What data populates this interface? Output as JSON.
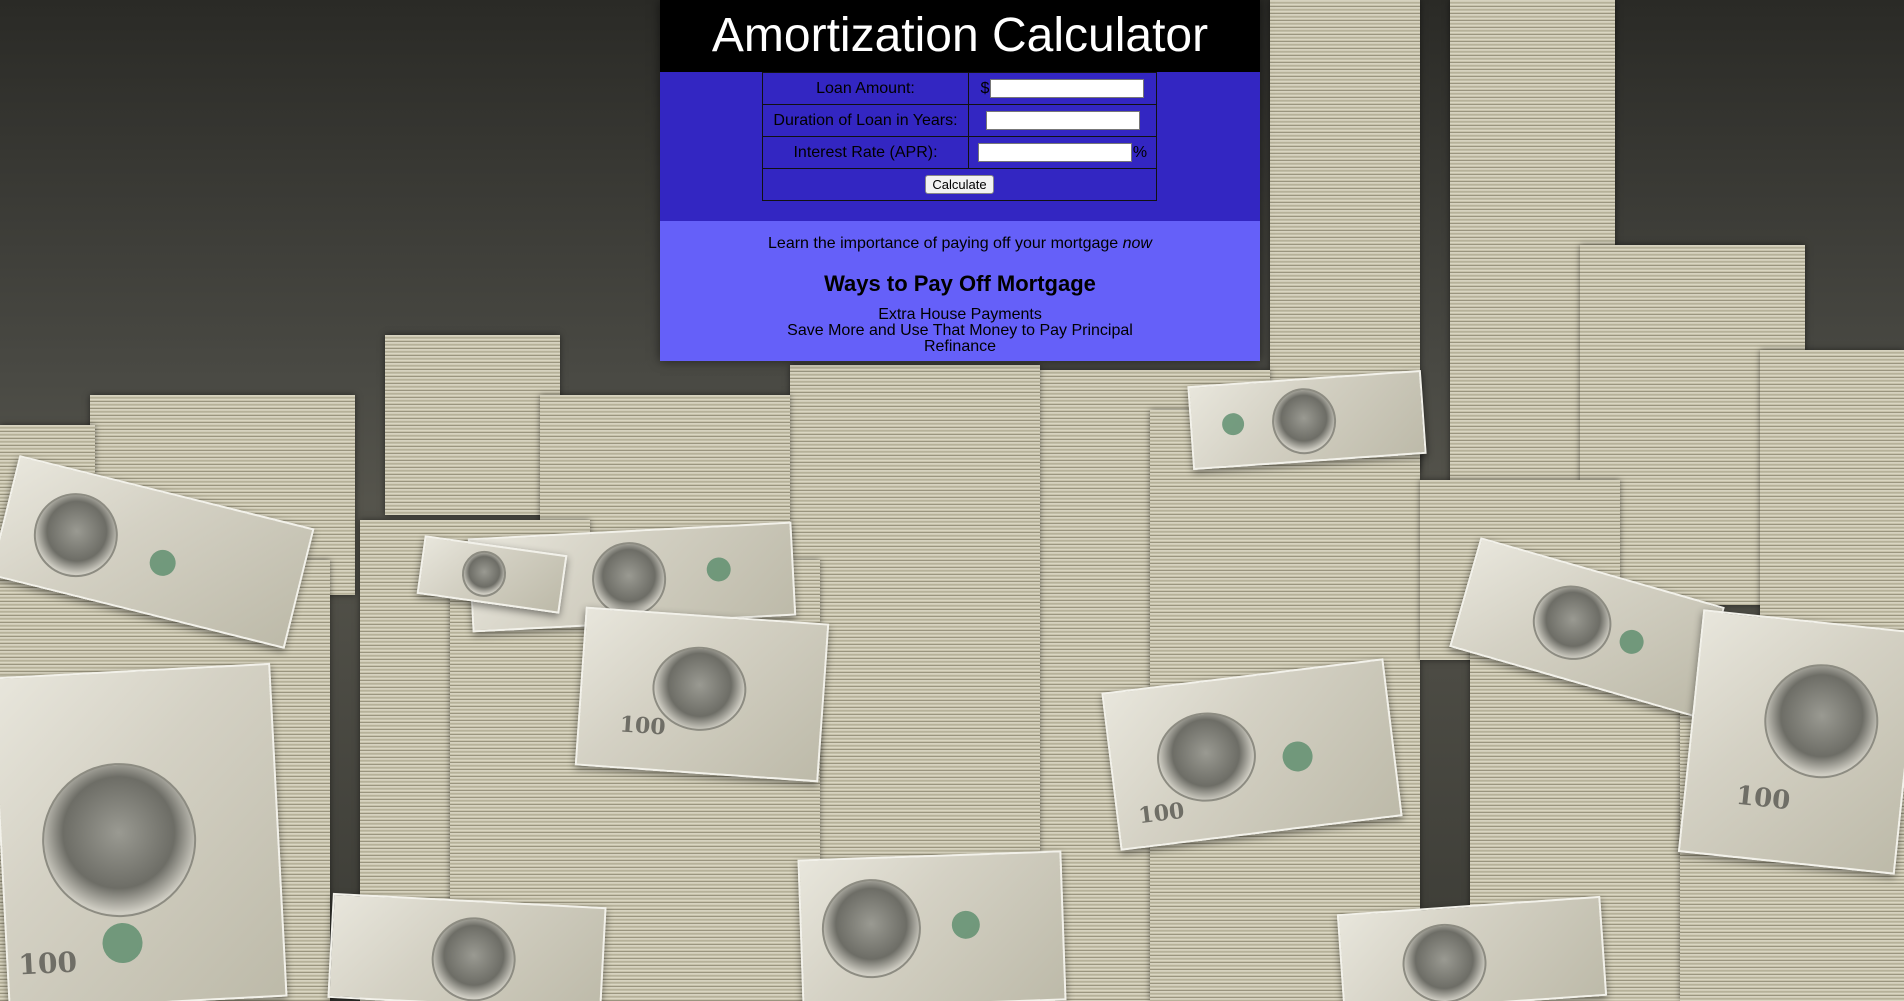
{
  "page": {
    "title": "Amortization Calculator"
  },
  "form": {
    "loan_amount_label": "Loan Amount:",
    "loan_amount_prefix": "$",
    "loan_amount_value": "",
    "duration_label": "Duration of Loan in Years:",
    "duration_value": "",
    "interest_label": "Interest Rate (APR):",
    "interest_value": "",
    "interest_suffix": "%",
    "calculate_label": "Calculate"
  },
  "info": {
    "learn_text": "Learn the importance of paying off your mortgage",
    "learn_emphasis": "now",
    "heading": "Ways to Pay Off Mortgage",
    "ways": [
      "Extra House Payments",
      "Save More and Use That Money to Pay Principal",
      "Refinance"
    ]
  },
  "colors": {
    "header_bg": "#000000",
    "form_bg": "#3326c2",
    "info_bg": "#6560f9"
  },
  "background": {
    "icon": "money-stacks-photo"
  }
}
